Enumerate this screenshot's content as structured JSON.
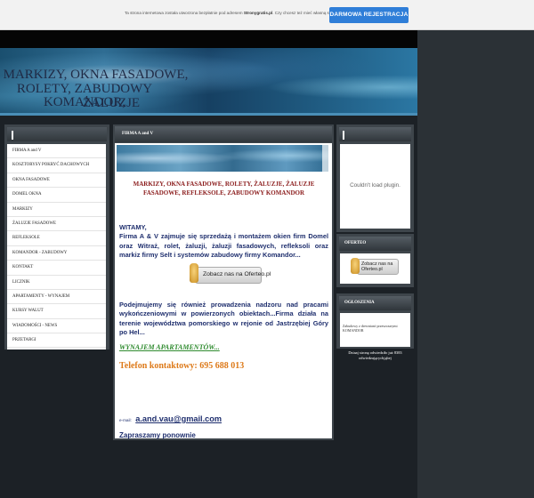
{
  "topbar": {
    "message_pre": "Ta strona internetowa została utworzona bezpłatnie pod adresem",
    "message_domain": "Stronygratis.pl",
    "message_post": ". Czy chcesz też mieć własną stronę?",
    "register_button": "DARMOWA REJESTRACJA",
    "button_color": "#2f7ed8"
  },
  "header": {
    "title_lines": [
      "MARKIZY, OKNA FASADOWE,",
      "ROLETY, ZABUDOWY KOMANDOR,",
      "ŻALUZJE"
    ]
  },
  "sidebar": {
    "items": [
      "FIRMA A and V",
      "KOSZTORYSY POKRYĆ DACHOWYCH",
      "OKNA FASADOWE",
      "DOMEL OKNA",
      "MARKIZY",
      "ŻALUZJE FASADOWE",
      "REFLEKSOLE",
      "KOMANDOR - ZABUDOWY",
      "KONTAKT",
      "LICZNIK",
      "APARTAMENTY - WYNAJEM",
      "KURSY WALUT",
      "WIADOMOŚCI - NEWS",
      "PRZETARGI"
    ]
  },
  "main": {
    "section_title": "FIRMA A and V",
    "heading": "MARKIZY, OKNA FASADOWE, ROLETY, ŻALUZJE, ŻALUZJE FASADOWE, REFLEKSOLE, ZABUDOWY KOMANDOR",
    "welcome": "WITAMY,",
    "intro": "Firma A & V zajmuje się sprzedażą i montażem okien firm Domel oraz Witraż, rolet, żaluzji, żaluzji fasadowych, refleksoli oraz markiz firmy Selt i systemów zabudowy firmy Komandor...",
    "badge_label": "Zobacz nas na Oferteo.pl",
    "paragraph2": "Podejmujemy się również prowadzenia nadzoru nad pracami wykończeniowymi w powierzonych obiektach...Firma działa na terenie województwa pomorskiego w rejonie od Jastrzębiej Góry po Hel...",
    "rent_link": "WYNAJEM APARTAMENTÓW...",
    "phone": "Telefon kontaktowy: 695 688 013",
    "email_prefix": "e-mail:",
    "email": "a.and.vau@gmail.com",
    "closing": "Zapraszamy ponownie"
  },
  "right": {
    "plugin_message": "Couldn't load plugin.",
    "oferteo_title": "OFERTEO",
    "oferteo_badge": "Zobacz nas na Oferteo.pl",
    "ads_title": "OGŁOSZENIA",
    "ads_text": "Zabudowy z drewnianć przeszczarymi KOMANDOR",
    "visits_text": "Dziaaj stronę odwiedziło już 8383 odwiedzającychjąbej"
  }
}
